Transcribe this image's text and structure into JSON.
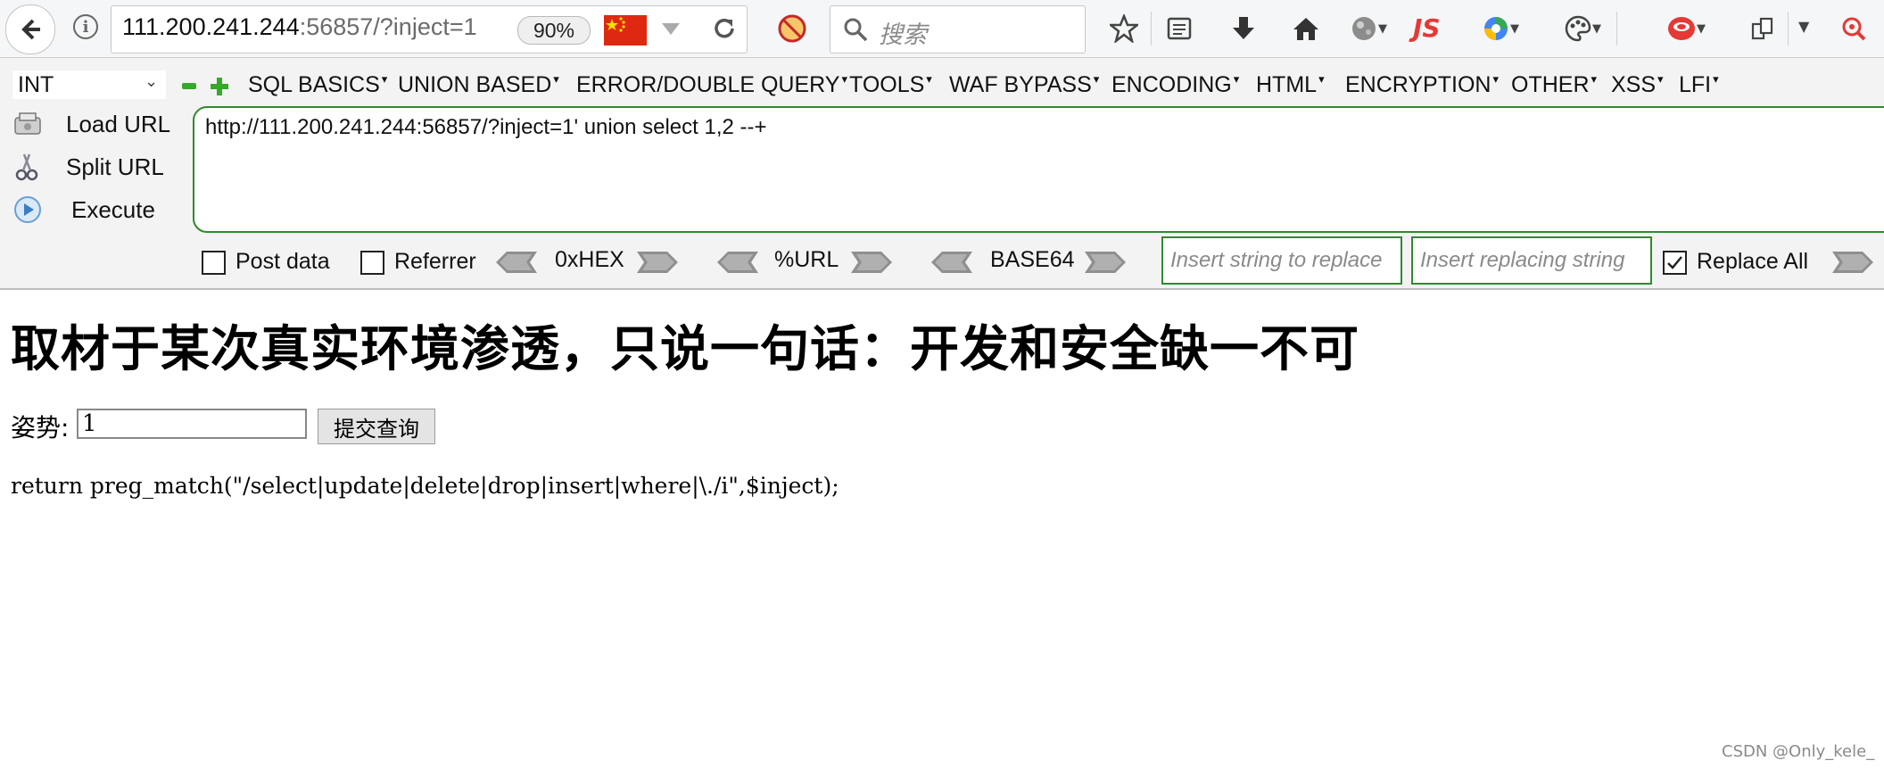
{
  "browser": {
    "url_host": "111.200.241.244",
    "url_rest": ":56857/?inject=1",
    "zoom": "90%",
    "search_placeholder": "搜索",
    "toolbar_icons": [
      "back-icon",
      "info-icon",
      "china-flag-icon",
      "dropdown-icon",
      "reload-icon",
      "blocked-icon",
      "search-icon",
      "star-icon",
      "reader-icon",
      "download-icon",
      "home-icon",
      "globe-icon",
      "js-icon",
      "translate-icon",
      "palette-icon",
      "pocket-icon",
      "clipboard-icon",
      "extensions-icon"
    ],
    "js_badge": "JS"
  },
  "hackbar": {
    "type_select": "INT",
    "menus": [
      "SQL BASICS",
      "UNION BASED",
      "ERROR/DOUBLE QUERY",
      "TOOLS",
      "WAF BYPASS",
      "ENCODING",
      "HTML",
      "ENCRYPTION",
      "OTHER",
      "XSS",
      "LFI"
    ],
    "load_url": "Load URL",
    "split_url": "Split URL",
    "execute": "Execute",
    "url_value": "http://111.200.241.244:56857/?inject=1' union select 1,2 --+",
    "post_data": "Post data",
    "referrer": "Referrer",
    "hex": "0xHEX",
    "url_enc": "%URL",
    "base64": "BASE64",
    "replace_from_placeholder": "Insert string to replace",
    "replace_to_placeholder": "Insert replacing string",
    "replace_all": "Replace All",
    "replace_all_checked": true
  },
  "page": {
    "heading": "取材于某次真实环境渗透，只说一句话：开发和安全缺一不可",
    "form_label": "姿势:",
    "input_value": "1",
    "submit_label": "提交查询",
    "code": "return preg_match(\"/select|update|delete|drop|insert|where|\\./i\",$inject);"
  },
  "watermark": "CSDN @Only_kele_"
}
